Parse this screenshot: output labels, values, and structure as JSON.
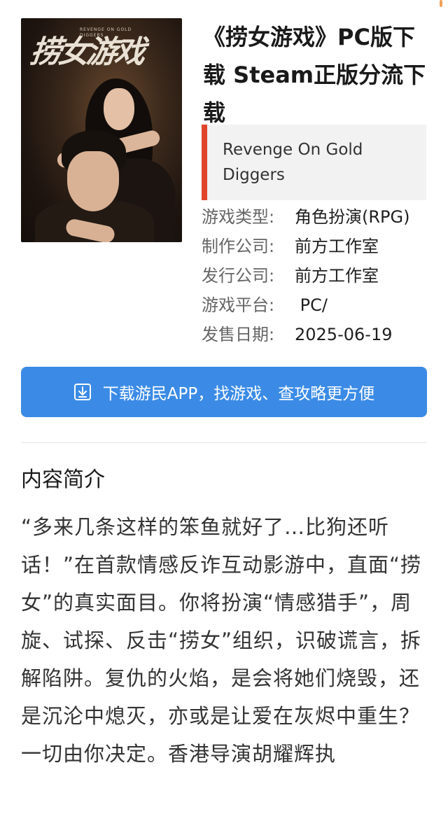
{
  "game": {
    "title": "《捞女游戏》PC版下载 Steam正版分流下载",
    "alt_title": "Revenge On Gold Diggers",
    "cover": {
      "title_text": "捞女游戏",
      "subtitle_text": "REVENGE ON GOLD DIGGERS"
    },
    "info": [
      {
        "label": "游戏类型:",
        "value": "角色扮演(RPG)"
      },
      {
        "label": "制作公司:",
        "value": "前方工作室"
      },
      {
        "label": "发行公司:",
        "value": "前方工作室"
      },
      {
        "label": "游戏平台:",
        "value": " PC/"
      },
      {
        "label": "发售日期:",
        "value": "2025-06-19"
      }
    ]
  },
  "download_button": {
    "label": "下载游民APP，找游戏、查攻略更方便",
    "icon": "download-icon"
  },
  "section": {
    "title": "内容简介",
    "body": "“多来几条这样的笨鱼就好了…比狗还听话！”在首款情感反诈互动影游中，直面“捞女”的真实面目。你将扮演“情感猎手”，周旋、试探、反击“捞女”组织，识破谎言，拆解陷阱。复仇的火焰，是会将她们烧毁，还是沉沦中熄灭，亦或是让爱在灰烬中重生？一切由你决定。香港导演胡耀辉执"
  },
  "colors": {
    "accent_bar": "#e0452c",
    "button_bg": "#3b8be6",
    "alt_box_bg": "#f2f2f2"
  }
}
